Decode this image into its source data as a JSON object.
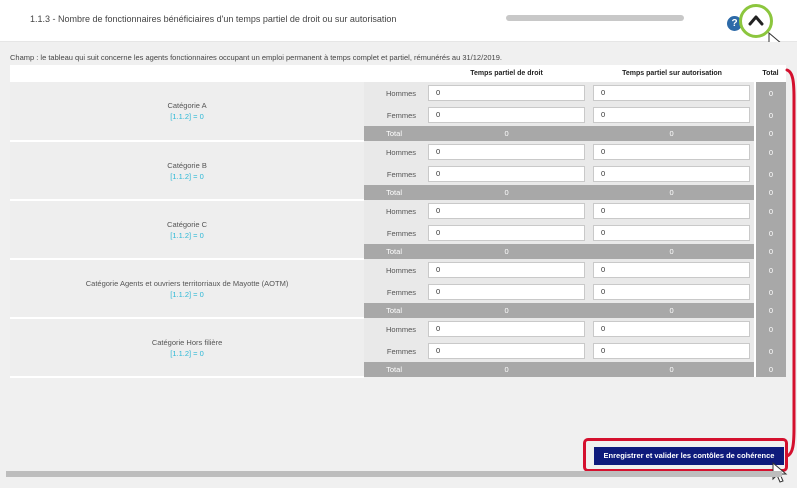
{
  "header": {
    "title": "1.1.3 - Nombre de fonctionnaires bénéficiaires d'un temps partiel de droit ou sur autorisation",
    "help_glyph": "?"
  },
  "champ_text": "Champ : le tableau qui suit concerne les agents fonctionnaires occupant un emploi permanent à temps complet et partiel, rémunérés au 31/12/2019.",
  "columns": {
    "col1": "Temps partiel de droit",
    "col2": "Temps partiel sur autorisation",
    "total": "Total"
  },
  "row_labels": {
    "hommes": "Hommes",
    "femmes": "Femmes",
    "total": "Total"
  },
  "categories": [
    {
      "name": "Catégorie A",
      "ref": "[1.1.2] = 0",
      "hommes": [
        "0",
        "0",
        "0"
      ],
      "femmes": [
        "0",
        "0",
        "0"
      ],
      "totals": [
        "0",
        "0",
        "0"
      ]
    },
    {
      "name": "Catégorie B",
      "ref": "[1.1.2] = 0",
      "hommes": [
        "0",
        "0",
        "0"
      ],
      "femmes": [
        "0",
        "0",
        "0"
      ],
      "totals": [
        "0",
        "0",
        "0"
      ]
    },
    {
      "name": "Catégorie C",
      "ref": "[1.1.2] = 0",
      "hommes": [
        "0",
        "0",
        "0"
      ],
      "femmes": [
        "0",
        "0",
        "0"
      ],
      "totals": [
        "0",
        "0",
        "0"
      ]
    },
    {
      "name": "Catégorie Agents et ouvriers territorriaux de Mayotte (AOTM)",
      "ref": "[1.1.2] = 0",
      "hommes": [
        "0",
        "0",
        "0"
      ],
      "femmes": [
        "0",
        "0",
        "0"
      ],
      "totals": [
        "0",
        "0",
        "0"
      ]
    },
    {
      "name": "Catégorie Hors filière",
      "ref": "[1.1.2] = 0",
      "hommes": [
        "0",
        "0",
        "0"
      ],
      "femmes": [
        "0",
        "0",
        "0"
      ],
      "totals": [
        "0",
        "0",
        "0"
      ]
    }
  ],
  "save_button": "Enregistrer et valider les contôles de cohérence",
  "colors": {
    "accent_green": "#8cc63e",
    "annotation_red": "#d4102e",
    "button_navy": "#0e1a7c",
    "ref_cyan": "#2eb8d6"
  }
}
